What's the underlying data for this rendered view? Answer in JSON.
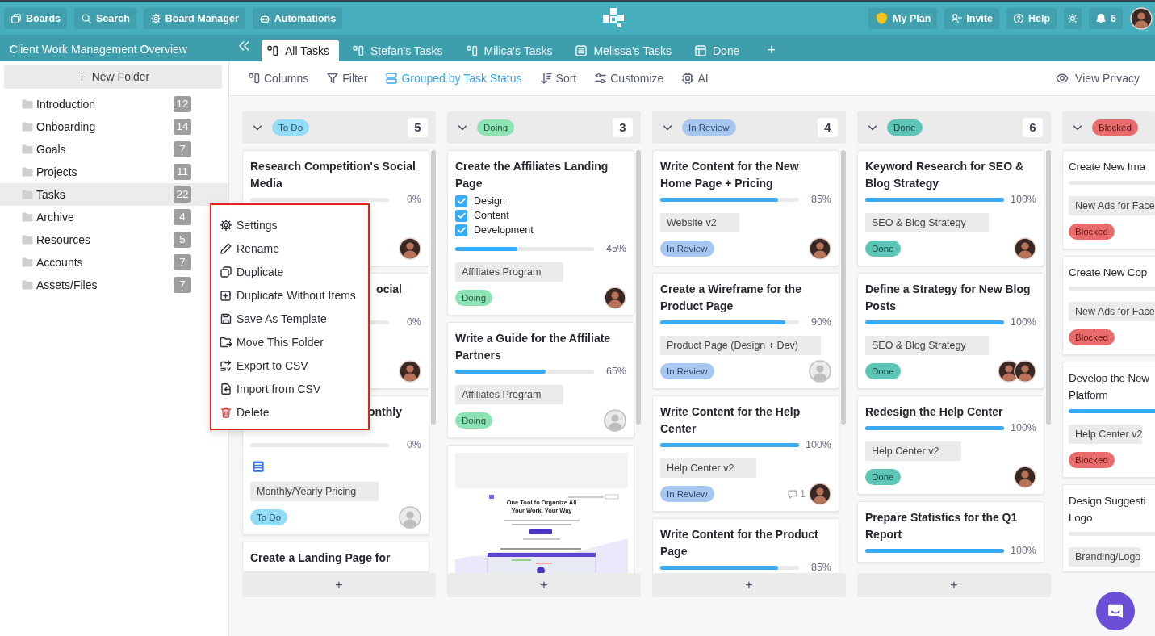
{
  "topbar": {
    "left_buttons": [
      {
        "label": "Boards"
      },
      {
        "label": "Search"
      },
      {
        "label": "Board Manager"
      },
      {
        "label": "Automations"
      }
    ],
    "right_buttons": [
      {
        "label": "My Plan"
      },
      {
        "label": "Invite"
      },
      {
        "label": "Help"
      }
    ],
    "notifications": {
      "count": "6"
    }
  },
  "board_title": "Client Work Management Overview",
  "tabs": [
    {
      "label": "All Tasks",
      "kind": "board",
      "selected": true
    },
    {
      "label": "Stefan's Tasks",
      "kind": "board",
      "selected": false
    },
    {
      "label": "Milica's Tasks",
      "kind": "board",
      "selected": false
    },
    {
      "label": "Melissa's Tasks",
      "kind": "list",
      "selected": false
    },
    {
      "label": "Done",
      "kind": "table",
      "selected": false
    }
  ],
  "add_tab": "+",
  "sidebar": {
    "new_folder": "New Folder",
    "folders": [
      {
        "name": "Introduction",
        "count": "12",
        "selected": false
      },
      {
        "name": "Onboarding",
        "count": "14",
        "selected": false
      },
      {
        "name": "Goals",
        "count": "7",
        "selected": false
      },
      {
        "name": "Projects",
        "count": "11",
        "selected": false
      },
      {
        "name": "Tasks",
        "count": "22",
        "selected": true
      },
      {
        "name": "Archive",
        "count": "4",
        "selected": false
      },
      {
        "name": "Resources",
        "count": "5",
        "selected": false
      },
      {
        "name": "Accounts",
        "count": "7",
        "selected": false
      },
      {
        "name": "Assets/Files",
        "count": "7",
        "selected": false
      }
    ]
  },
  "toolbar": {
    "items": [
      {
        "label": "Columns",
        "active": false
      },
      {
        "label": "Filter",
        "active": false
      },
      {
        "label": "Grouped by Task Status",
        "active": true
      },
      {
        "label": "Sort",
        "active": false
      },
      {
        "label": "Customize",
        "active": false
      },
      {
        "label": "AI",
        "active": false
      }
    ],
    "view_privacy": "View Privacy"
  },
  "columns": [
    {
      "status": {
        "label": "To Do",
        "kind": "todo"
      },
      "count": "5",
      "add_label": "+",
      "cards": [
        {
          "kind": "task",
          "title": "Research Competition's Social Media",
          "progress": {
            "level": 0,
            "reading": "0%"
          },
          "avatars": [
            {
              "kind": "photo"
            }
          ]
        },
        {
          "kind": "covered",
          "title": "ocial",
          "progress": {
            "level": 0,
            "reading": "0%"
          },
          "avatars": [
            {
              "kind": "photo"
            }
          ]
        },
        {
          "kind": "covered",
          "title": "onthly",
          "progress": {
            "level": 0,
            "reading": "0%"
          },
          "doc": true,
          "tag": "Monthly/Yearly Pricing",
          "status": {
            "label": "To Do",
            "kind": "todo"
          },
          "avatars": [
            {
              "kind": "placeholder"
            }
          ]
        },
        {
          "kind": "task",
          "title": "Create a Landing Page for"
        }
      ]
    },
    {
      "status": {
        "label": "Doing",
        "kind": "doing"
      },
      "count": "3",
      "add_label": "+",
      "cards": [
        {
          "kind": "task",
          "title": "Create the Affiliates Landing Page",
          "checklist": [
            {
              "label": "Design",
              "checked": true
            },
            {
              "label": "Content",
              "checked": true
            },
            {
              "label": "Development",
              "checked": true
            }
          ],
          "progress": {
            "level": 0.45,
            "reading": "45%"
          },
          "tag": "Affiliates Program",
          "status": {
            "label": "Doing",
            "kind": "doing"
          },
          "avatars": [
            {
              "kind": "photo"
            }
          ]
        },
        {
          "kind": "task",
          "title": "Write a Guide for the Affiliate Partners",
          "progress": {
            "level": 0.65,
            "reading": "65%"
          },
          "tag": "Affiliates Program",
          "status": {
            "label": "Doing",
            "kind": "doing"
          },
          "avatars": [
            {
              "kind": "placeholder"
            }
          ]
        },
        {
          "kind": "preview",
          "heading": "One Tool to Organize All Your Work, Your Way"
        }
      ]
    },
    {
      "status": {
        "label": "In Review",
        "kind": "review"
      },
      "count": "4",
      "add_label": "+",
      "cards": [
        {
          "kind": "task",
          "title": "Write Content for the New Home Page + Pricing",
          "progress": {
            "level": 0.85,
            "reading": "85%"
          },
          "tag": "Website v2",
          "status": {
            "label": "In Review",
            "kind": "review"
          },
          "avatars": [
            {
              "kind": "photo"
            }
          ]
        },
        {
          "kind": "task",
          "title": "Create a Wireframe for the Product Page",
          "progress": {
            "level": 0.9,
            "reading": "90%"
          },
          "tag": "Product Page (Design + Dev)",
          "status": {
            "label": "In Review",
            "kind": "review"
          },
          "avatars": [
            {
              "kind": "placeholder"
            }
          ]
        },
        {
          "kind": "task",
          "title": "Write Content for the Help Center",
          "progress": {
            "level": 1,
            "reading": "100%"
          },
          "tag": "Help Center v2",
          "status": {
            "label": "In Review",
            "kind": "review"
          },
          "comments": "1",
          "avatars": [
            {
              "kind": "photo"
            }
          ]
        },
        {
          "kind": "task",
          "title": "Write Content for the Product Page",
          "progress": {
            "level": 0.85,
            "reading": "85%"
          }
        }
      ]
    },
    {
      "status": {
        "label": "Done",
        "kind": "done"
      },
      "count": "6",
      "add_label": "+",
      "cards": [
        {
          "kind": "task",
          "title": "Keyword Research for SEO & Blog Strategy",
          "progress": {
            "level": 1,
            "reading": "100%"
          },
          "tag": "SEO & Blog Strategy",
          "status": {
            "label": "Done",
            "kind": "done"
          },
          "avatars": [
            {
              "kind": "photo"
            }
          ]
        },
        {
          "kind": "task",
          "title": "Define a Strategy for New Blog Posts",
          "progress": {
            "level": 1,
            "reading": "100%"
          },
          "tag": "SEO & Blog Strategy",
          "status": {
            "label": "Done",
            "kind": "done"
          },
          "avatars": [
            {
              "kind": "photo"
            },
            {
              "kind": "photo"
            }
          ]
        },
        {
          "kind": "task",
          "title": "Redesign the Help Center",
          "progress": {
            "level": 1,
            "reading": "100%"
          },
          "tag": "Help Center v2",
          "status": {
            "label": "Done",
            "kind": "done"
          },
          "avatars": [
            {
              "kind": "photo"
            }
          ]
        },
        {
          "kind": "task",
          "title": "Prepare Statistics for the Q1 Report",
          "progress": {
            "level": 1,
            "reading": "100%"
          }
        }
      ]
    },
    {
      "status": {
        "label": "Blocked",
        "kind": "blocked"
      },
      "cards": [
        {
          "kind": "task",
          "title": "Create New Ima",
          "progress": {
            "level": 0
          },
          "tag": "New Ads for Face",
          "status": {
            "label": "Blocked",
            "kind": "blocked"
          }
        },
        {
          "kind": "task",
          "title": "Create New Cop",
          "progress": {
            "level": 0
          },
          "tag": "New Ads for Face",
          "status": {
            "label": "Blocked",
            "kind": "blocked"
          }
        },
        {
          "kind": "task",
          "title": "Develop the New\nPlatform",
          "progress": {
            "level": 1
          },
          "tag": "Help Center v2",
          "status": {
            "label": "Blocked",
            "kind": "blocked"
          }
        },
        {
          "kind": "task",
          "title": "Design Suggesti\nLogo",
          "progress": {
            "level": 0
          },
          "tag": "Branding/Logo"
        }
      ]
    }
  ],
  "context_menu": {
    "items": [
      {
        "label": "Settings",
        "kind": "normal"
      },
      {
        "label": "Rename",
        "kind": "normal"
      },
      {
        "label": "Duplicate",
        "kind": "normal"
      },
      {
        "label": "Duplicate Without Items",
        "kind": "normal"
      },
      {
        "label": "Save As Template",
        "kind": "normal"
      },
      {
        "label": "Move This Folder",
        "kind": "normal"
      },
      {
        "label": "Export to CSV",
        "kind": "normal"
      },
      {
        "label": "Import from CSV",
        "kind": "normal"
      },
      {
        "label": "Delete",
        "kind": "danger"
      }
    ]
  }
}
